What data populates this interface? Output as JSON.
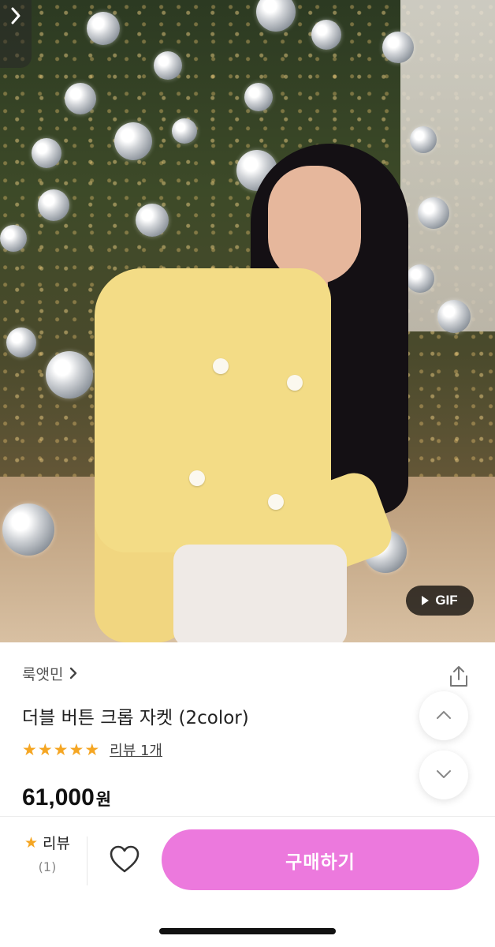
{
  "hero": {
    "gif_label": "GIF"
  },
  "product": {
    "shop_name": "룩앳민",
    "title": "더블 버튼 크롭 자켓 (2color)",
    "rating_stars": 5,
    "review_link": "리뷰 1개",
    "price_number": "61,000",
    "price_unit": "원"
  },
  "bottom_bar": {
    "review_label": "리뷰",
    "review_count": "(1)",
    "buy_label": "구매하기"
  },
  "colors": {
    "buy_button": "#ec79dd",
    "star": "#f5a623"
  },
  "icons": [
    "back-icon",
    "play-icon",
    "share-icon",
    "chevron-up-icon",
    "chevron-down-icon",
    "star-icon",
    "heart-icon"
  ]
}
